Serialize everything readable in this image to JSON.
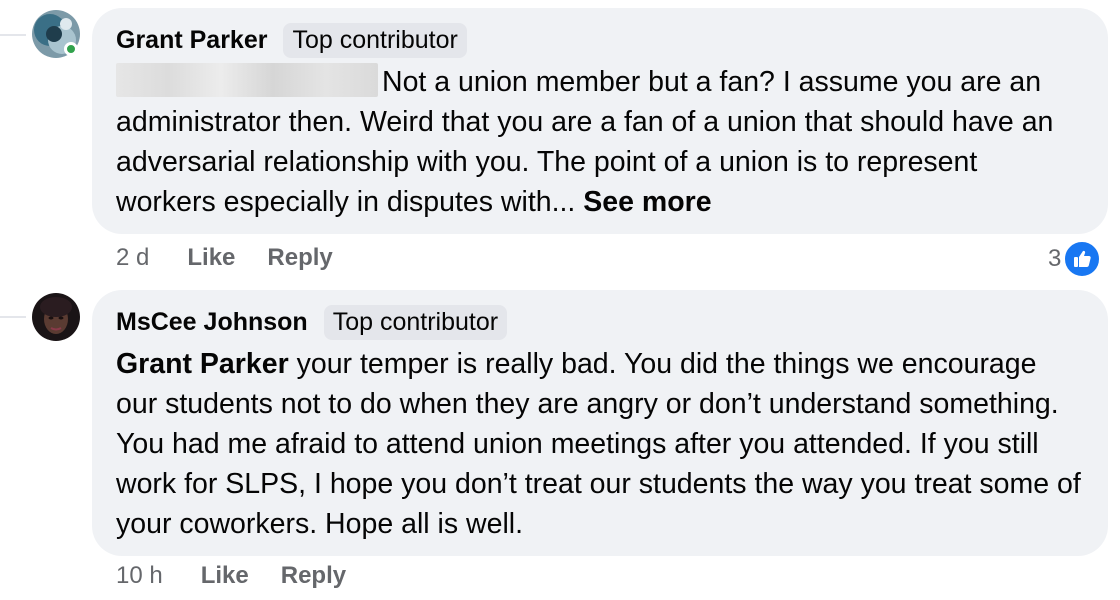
{
  "comments": [
    {
      "author": "Grant Parker",
      "badge": "Top contributor",
      "text": "Not a union member but a fan? I assume you are an administrator then. Weird that you are a fan of a union that should have an adversarial relationship with you. The point of a union is to represent workers especially in disputes with...",
      "see_more": "See more",
      "time": "2 d",
      "like_label": "Like",
      "reply_label": "Reply",
      "reaction_count": "3",
      "reaction_icon": "thumbs-up-icon",
      "online": true
    },
    {
      "author": "MsCee Johnson",
      "badge": "Top contributor",
      "mention": "Grant Parker",
      "text": "your temper is really bad. You did the things we encourage our students not to do when they are angry or don’t understand something. You had me afraid to attend union meetings after you attended. If you still work for SLPS, I hope you don’t treat our students the way you treat some of your coworkers. Hope all is well.",
      "time": "10 h",
      "like_label": "Like",
      "reply_label": "Reply"
    }
  ],
  "colors": {
    "bubble": "#f0f2f5",
    "badge": "#e4e6eb",
    "meta_text": "#65676b",
    "like_blue": "#1877f2",
    "online_green": "#31a24c"
  }
}
